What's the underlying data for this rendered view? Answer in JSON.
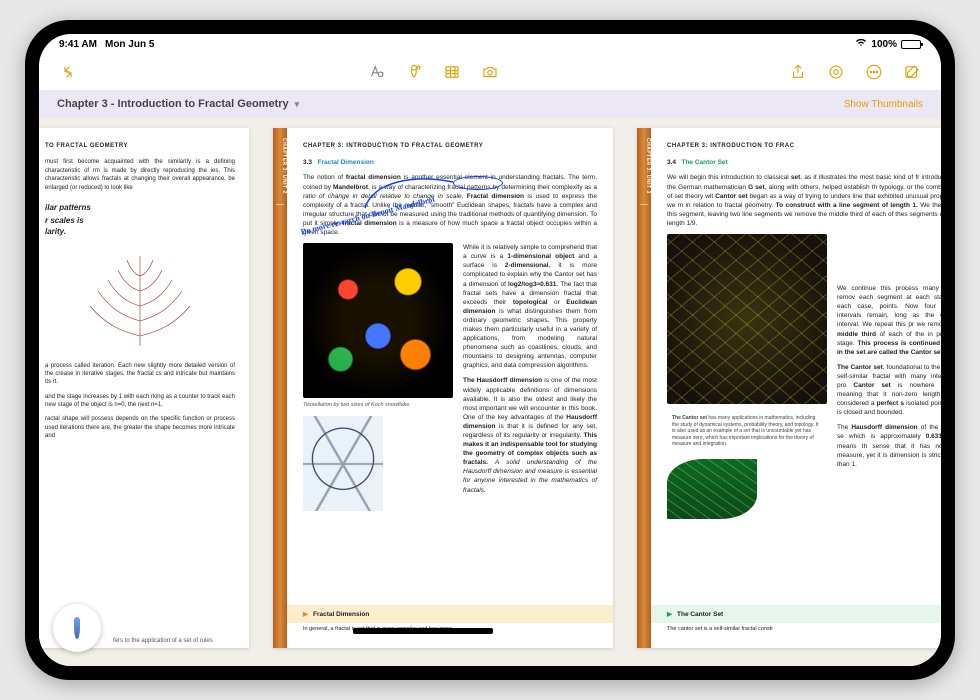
{
  "statusbar": {
    "time": "9:41 AM",
    "date": "Mon Jun 5",
    "battery": "100%"
  },
  "toolbar": {
    "icons": {
      "collapse": "collapse-icon",
      "text": "text-style-icon",
      "highlighter": "highlighter-icon",
      "table": "table-icon",
      "camera": "camera-icon",
      "share": "share-icon",
      "target": "target-icon",
      "more": "more-icon",
      "compose": "compose-icon"
    }
  },
  "breadcrumb": {
    "title": "Chapter 3 - Introduction to Fractal Geometry",
    "right": "Show Thumbnails"
  },
  "page1": {
    "run_head": "TO FRACTAL GEOMETRY",
    "p1": "must first become acquainted with the similarity is a defining characteristic of rm is made by directly reproducing the ies. This characteristic allows fractals at changing their overall appearance. be enlarged (or reduced) to look like",
    "callout1": "ilar patterns",
    "callout2": "r scales is",
    "callout3": "larity.",
    "p2": "a process called iteration. Each new slightly more detailed version of the crease in iterative stages, the fractal cs and intricate but maintains its rt.",
    "p3": "and the stage increases by 1 with each rking as a counter to track each new stage of the object is n=0, the next n=1,",
    "p4": "ractal shape will possess depends on the specific function or process used iterations there are, the greater the shape becomes more intricate and",
    "footer": "fers to the application of a set of rules"
  },
  "page2": {
    "spine": "CHAPTER 3: UNIT 2",
    "run_head_a": "CHAPTER 3:",
    "run_head_b": "INTRODUCTION TO FRACTAL GEOMETRY",
    "sec_num": "3.3",
    "sec_title": "Fractal Dimension",
    "p1a": "The notion of ",
    "p1b": "fractal dimension",
    "p1c": " is another essential element in understanding fractals. The term, coined by ",
    "p1d": "Mandelbrot",
    "p1e": ", is a way of characterizing fractal patterns by determining their complexity as a ",
    "p1f": "ratio of change in detail relative to change in scale",
    "p1g": ". ",
    "p1h": "Fractal dimension",
    "p1i": " is used to express the complexity of a fractal. Unlike the regular, \"smooth\" Euclidean shapes, fractals have a complex and irregular structure that cannot be measured using the traditional methods of quantifying dimension. To put it simply, ",
    "p1j": "fractal dimension",
    "p1k": " is a measure of how much space a fractal object occupies within a given space.",
    "p2a": "While it is relatively simple to comprehend that a curve is a ",
    "p2b": "1-dimensional object",
    "p2c": " and a surface is ",
    "p2d": "2-dimensional",
    "p2e": ", it is more complicated to explain why the Cantor set has a dimension of ",
    "p2f": "log2/log3≈0.631",
    "p2g": ". The fact that fractal sets have a dimension fractal that exceeds their ",
    "p2h": "topological",
    "p2i": " or ",
    "p2j": "Euclidean dimension",
    "p2k": " is what distinguishes them from ordinary geometric shapes. This property makes them particularly useful in a variety of applications, from modeling natural phenomena such as coastlines, clouds, and mountains to designing antennas, computer graphics, and data compression algorithms.",
    "caption": "Tessellation by two sizes of Koch snowflake",
    "p3a": "The Hausdorff dimension",
    "p3b": " is one of the most widely applicable definitions of dimensions available. It is also the oldest and likely the most important we will encounter in this book. One of the key advantages of the ",
    "p3c": "Hausdorff dimension",
    "p3d": " is that it is defined for any set, regardless of its regularity or irregularity. ",
    "p3e": "This makes it an indispensable tool for studying the geometry of complex objects such as fractals.",
    "p3f": " A solid understanding of the Hausdorff dimension and measure is essential for anyone interested in the mathematics of fractals.",
    "bar": "Fractal Dimension",
    "tiny": "In general, a fractal is set that is more complex and has more",
    "hand": "Do more research on Benoit Mandelbrot"
  },
  "page3": {
    "spine": "CHAPTER 3: UNIT 3",
    "run_head_a": "CHAPTER 3:",
    "run_head_b": "INTRODUCTION TO FRAC",
    "sec_num": "3.4",
    "sec_title": "The Cantor Set",
    "p1a": "We will begin this introduction to classical ",
    "p1b": "set",
    "p1c": ", as it illustrates the most basic kind of fr introduced by the German mathematician ",
    "p1d": "G set",
    "p1e": ", along with others, helped establish th typology, or the combination of set theory wit ",
    "p1f": "Cantor set",
    "p1g": " began as a way of trying to unders line that exhibited unusual properties, we m in relation to fractal geometry. ",
    "p1h": "To construct with a line segment of length 1.",
    "p1i": " We then re of this segment, leaving two line segments we remove the middle third of each of thes segments each of length 1/9.",
    "p2a": "We continue this process many times, remov each segment at each stage. In each case, points. Now four closed intervals remain, long as the original interval. We repeat this pr we remove the ",
    "p2b": "middle third",
    "p2c": " of each of the in previous stage. ",
    "p2d": "This process is continued in left in the set are called the Cantor set.",
    "note_a": "The Cantor set",
    "note_b": " has many applications in mathematics, including the study of dynamical systems, probability theory, and topology. It is also used as an example of a set that is uncountable yet has measure zero, which has important implications for the theory of measure and integration.",
    "p3a": "The Cantor set",
    "p3b": ", foundational to the establi self-similar fractal with many interesting pro ",
    "p3c": "Cantor set",
    "p3d": " is nowhere dense, meaning that it non-zero length. It is considered a ",
    "p3e": "perfect s",
    "p3f": " isolated points and is closed and bounded.",
    "p4a": "The ",
    "p4b": "Hausdorff dimension",
    "p4c": " of the Cantor se which is approximately ",
    "p4d": "0.631",
    "p4e": ". This means th sense that it has non-zero measure, yet it is dimension is strictly less than 1.",
    "bar": "The Cantor Set",
    "tiny": "The cantor set is a self-similar fractal constr"
  }
}
